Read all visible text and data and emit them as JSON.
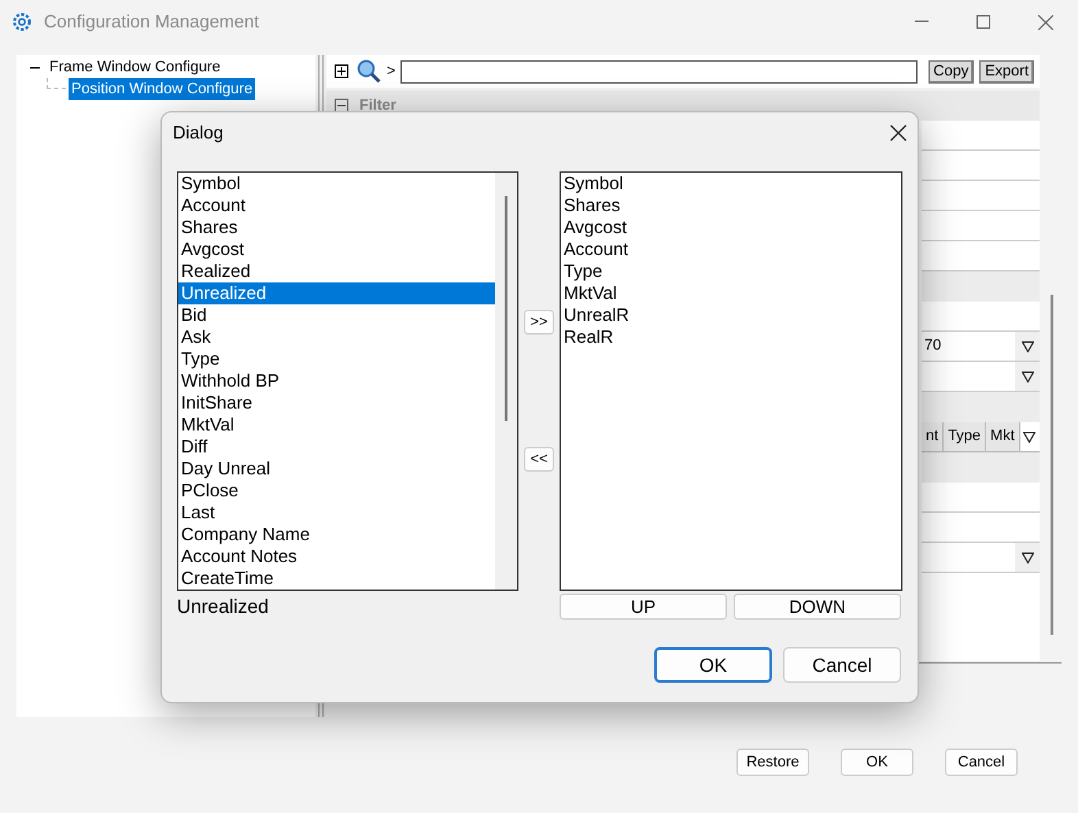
{
  "window": {
    "title": "Configuration Management"
  },
  "tree": [
    {
      "label": "Frame Window Configure",
      "expanded": true,
      "selected": false,
      "children": [
        {
          "label": "Position Window Configure",
          "selected": true
        }
      ]
    }
  ],
  "toolbar": {
    "prompt": ">",
    "buttons": [
      "Copy",
      "Export"
    ]
  },
  "filter_section": {
    "title": "Filter",
    "expanded": true
  },
  "settings_rows": [
    {
      "kind": "field"
    },
    {
      "kind": "field"
    },
    {
      "kind": "field"
    },
    {
      "kind": "field"
    },
    {
      "kind": "field"
    },
    {
      "kind": "band"
    },
    {
      "kind": "field"
    },
    {
      "kind": "dropdown",
      "value": "70"
    },
    {
      "kind": "dropdown"
    },
    {
      "kind": "band"
    },
    {
      "kind": "table_header",
      "columns": [
        "nt",
        "Type",
        "Mkt"
      ]
    },
    {
      "kind": "band"
    },
    {
      "kind": "field"
    },
    {
      "kind": "field"
    },
    {
      "kind": "dropdown"
    },
    {
      "kind": "tall"
    }
  ],
  "dialog": {
    "title": "Dialog",
    "available": [
      {
        "label": "Symbol",
        "selected": false
      },
      {
        "label": "Account",
        "selected": false
      },
      {
        "label": "Shares",
        "selected": false
      },
      {
        "label": "Avgcost",
        "selected": false
      },
      {
        "label": "Realized",
        "selected": false
      },
      {
        "label": "Unrealized",
        "selected": true
      },
      {
        "label": "Bid",
        "selected": false
      },
      {
        "label": "Ask",
        "selected": false
      },
      {
        "label": "Type",
        "selected": false
      },
      {
        "label": "Withhold BP",
        "selected": false
      },
      {
        "label": "InitShare",
        "selected": false
      },
      {
        "label": "MktVal",
        "selected": false
      },
      {
        "label": "Diff",
        "selected": false
      },
      {
        "label": "Day Unreal",
        "selected": false
      },
      {
        "label": "PClose",
        "selected": false
      },
      {
        "label": "Last",
        "selected": false
      },
      {
        "label": "Company Name",
        "selected": false
      },
      {
        "label": "Account Notes",
        "selected": false
      },
      {
        "label": "CreateTime",
        "selected": false
      }
    ],
    "selected_label": "Unrealized",
    "add_button": ">>",
    "remove_button": "<<",
    "chosen": [
      "Symbol",
      "Shares",
      "Avgcost",
      "Account",
      "Type",
      "MktVal",
      "UnrealR",
      "RealR"
    ],
    "up_button": "UP",
    "down_button": "DOWN",
    "ok_button": "OK",
    "cancel_button": "Cancel"
  },
  "footer_buttons": [
    "Restore",
    "OK",
    "Cancel"
  ]
}
